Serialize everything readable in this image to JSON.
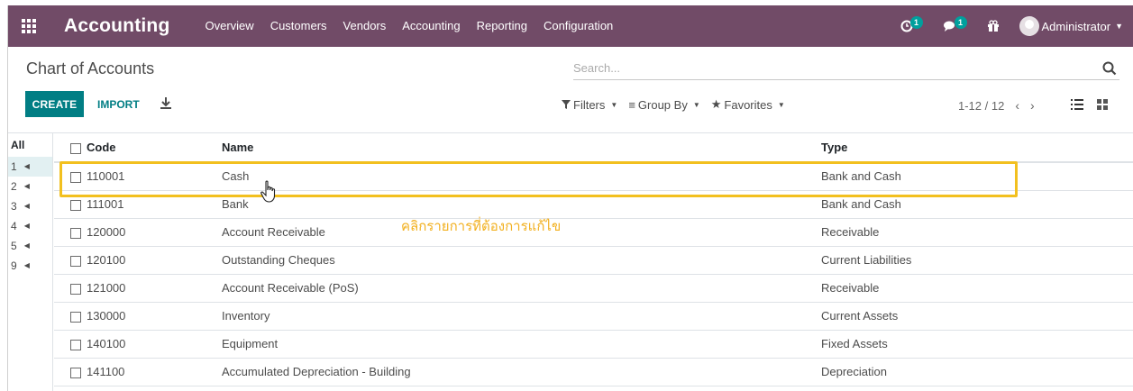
{
  "navbar": {
    "app_name": "Accounting",
    "menu": [
      "Overview",
      "Customers",
      "Vendors",
      "Accounting",
      "Reporting",
      "Configuration"
    ],
    "activity_count": "1",
    "messages_count": "1",
    "user_name": "Administrator",
    "color": "#714b67"
  },
  "control_panel": {
    "breadcrumb": "Chart of Accounts",
    "search_placeholder": "Search...",
    "create_label": "CREATE",
    "import_label": "IMPORT",
    "filters_label": "Filters",
    "group_by_label": "Group By",
    "favorites_label": "Favorites",
    "pager": "1-12 / 12"
  },
  "sidebar": {
    "all_label": "All",
    "items": [
      "1",
      "2",
      "3",
      "4",
      "5",
      "9"
    ],
    "active_index": 0
  },
  "table": {
    "headers": {
      "code": "Code",
      "name": "Name",
      "type": "Type"
    },
    "rows": [
      {
        "code": "110001",
        "name": "Cash",
        "type": "Bank and Cash"
      },
      {
        "code": "111001",
        "name": "Bank",
        "type": "Bank and Cash"
      },
      {
        "code": "120000",
        "name": "Account Receivable",
        "type": "Receivable"
      },
      {
        "code": "120100",
        "name": "Outstanding Cheques",
        "type": "Current Liabilities"
      },
      {
        "code": "121000",
        "name": "Account Receivable (PoS)",
        "type": "Receivable"
      },
      {
        "code": "130000",
        "name": "Inventory",
        "type": "Current Assets"
      },
      {
        "code": "140100",
        "name": "Equipment",
        "type": "Fixed Assets"
      },
      {
        "code": "141100",
        "name": "Accumulated Depreciation - Building",
        "type": "Depreciation"
      }
    ]
  },
  "annotation": {
    "text": "คลิกรายการที่ต้องการแก้ไข",
    "color": "#f2c01f"
  },
  "accent_color": "#017e84"
}
